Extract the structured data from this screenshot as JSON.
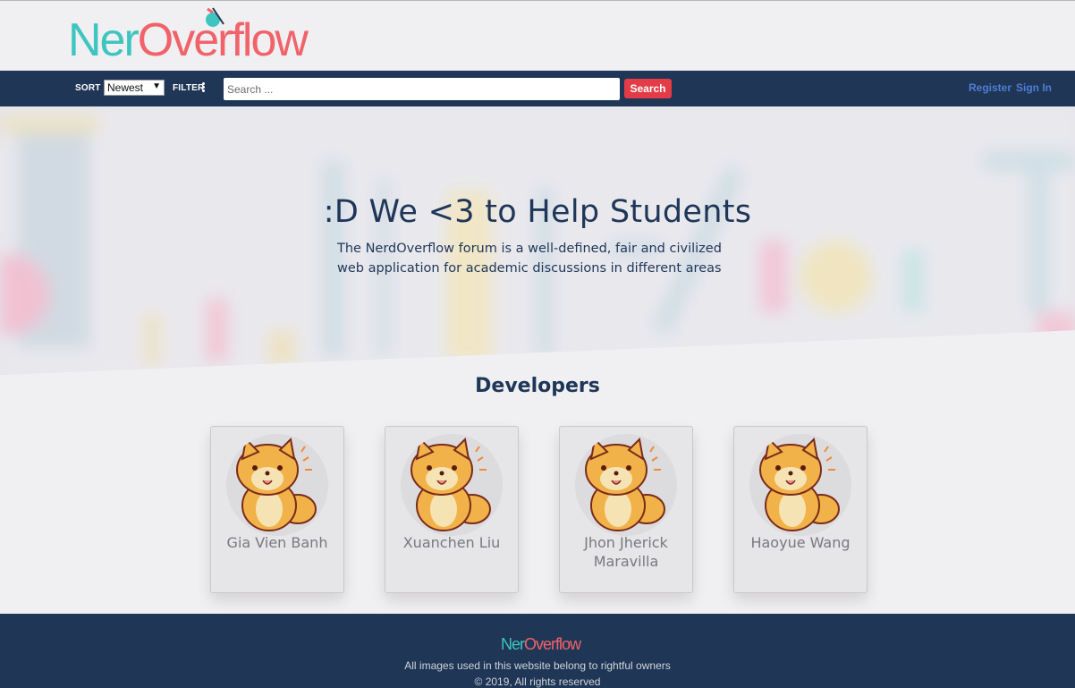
{
  "brand": {
    "logo_part1": "Ner",
    "logo_part2": "Overflow",
    "colors": {
      "teal": "#3ec5bf",
      "coral": "#f0636a",
      "navy": "#1f3656",
      "search_red": "#e33c47",
      "link_blue": "#4f7dd6"
    }
  },
  "navbar": {
    "sort_label": "SORT",
    "sort_value": "Newest",
    "filter_label": "FILTER",
    "search_placeholder": "Search ...",
    "search_button": "Search",
    "register": "Register",
    "sign_in": "Sign In"
  },
  "hero": {
    "title": ":D We <3 to Help Students",
    "subtitle": "The NerdOverflow forum is a well-defined, fair and civilized web application for academic discussions in different areas"
  },
  "developers": {
    "title": "Developers",
    "items": [
      {
        "name": "Gia Vien Banh"
      },
      {
        "name": "Xuanchen Liu"
      },
      {
        "name": "Jhon Jherick Maravilla"
      },
      {
        "name": "Haoyue Wang"
      }
    ]
  },
  "footer": {
    "notice": "All images used in this website belong to rightful owners",
    "copyright": "© 2019, All rights reserved"
  }
}
